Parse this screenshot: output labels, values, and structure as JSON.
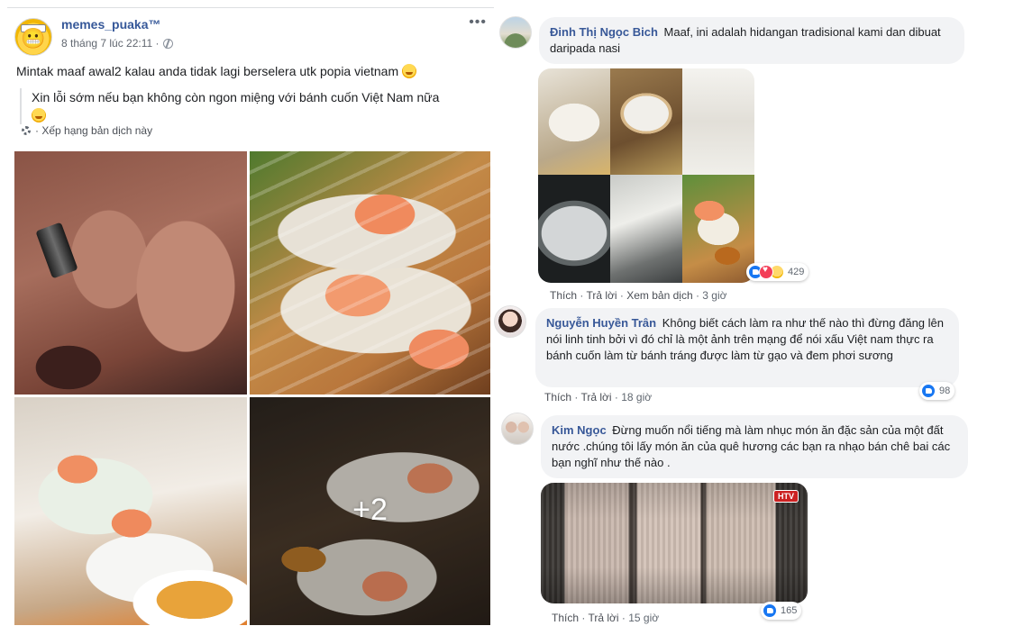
{
  "post": {
    "author": "memes_puaka™",
    "timestamp": "8 tháng 7 lúc 22:11 ·",
    "more_label": "•••",
    "text": "Mintak maaf awal2 kalau anda tidak lagi berselera utk popia vietnam",
    "translation": "Xin lỗi sớm nếu bạn không còn ngon miệng với bánh cuốn Việt Nam nữa",
    "rate_translation": "· Xếp hạng bản dịch này",
    "more_photos": "+2"
  },
  "comments": [
    {
      "author": "Đinh Thị Ngọc Bich",
      "text": "Maaf, ini adalah hidangan tradisional kami dan dibuat daripada nasi",
      "actions": {
        "like": "Thích",
        "reply": "Trả lời",
        "see_translation": "Xem bản dịch",
        "time": "3 giờ"
      },
      "reaction_count": "429"
    },
    {
      "author": "Nguyễn Huyền Trân",
      "text": "Không biết cách làm ra như thế nào thì đừng đăng lên nói linh tinh bởi vì đó chỉ là một ảnh trên mạng để nói xấu Việt nam thực ra bánh cuốn làm từ bánh tráng được làm từ gạo và đem phơi sương",
      "actions": {
        "like": "Thích",
        "reply": "Trả lời",
        "time": "18 giờ"
      },
      "reaction_count": "98"
    },
    {
      "author": "Kim Ngọc",
      "text": "Đừng muốn nổi tiếng mà làm nhục món ăn đặc sản của một đất nước .chúng tôi lấy món ăn của quê hương các bạn ra nhạo bán chê bai các bạn nghĩ như thế nào .",
      "actions": {
        "like": "Thích",
        "reply": "Trả lời",
        "time": "15 giờ"
      },
      "reaction_count": "165",
      "video_logo": "HTV"
    }
  ],
  "colors": {
    "link_blue": "#385898",
    "like_blue": "#1877f2",
    "bubble_bg": "#f2f3f5"
  }
}
